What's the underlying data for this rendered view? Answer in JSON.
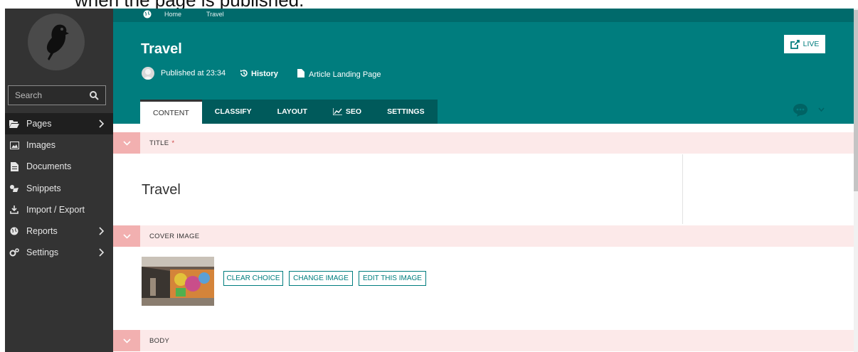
{
  "caption": "when the page is published.",
  "sidebar": {
    "search_placeholder": "Search",
    "items": [
      {
        "label": "Pages"
      },
      {
        "label": "Images"
      },
      {
        "label": "Documents"
      },
      {
        "label": "Snippets"
      },
      {
        "label": "Import / Export"
      },
      {
        "label": "Reports"
      },
      {
        "label": "Settings"
      }
    ]
  },
  "header": {
    "breadcrumb": [
      "Home",
      "Travel"
    ],
    "title": "Travel",
    "published": "Published at 23:34",
    "history": "History",
    "page_type": "Article Landing Page",
    "live_label": "LIVE",
    "tabs": [
      "CONTENT",
      "CLASSIFY",
      "LAYOUT",
      "SEO",
      "SETTINGS"
    ]
  },
  "content": {
    "sections": [
      "TITLE",
      "COVER IMAGE",
      "BODY"
    ],
    "required_mark": "*",
    "title_value": "Travel",
    "image_buttons": [
      "CLEAR CHOICE",
      "CHANGE IMAGE",
      "EDIT THIS IMAGE"
    ]
  },
  "colors": {
    "teal": "#007d7e",
    "teal_dark": "#006a6b",
    "sidebar": "#333333",
    "section_bg": "#fce9e9",
    "section_toggle": "#f2b0b0"
  }
}
